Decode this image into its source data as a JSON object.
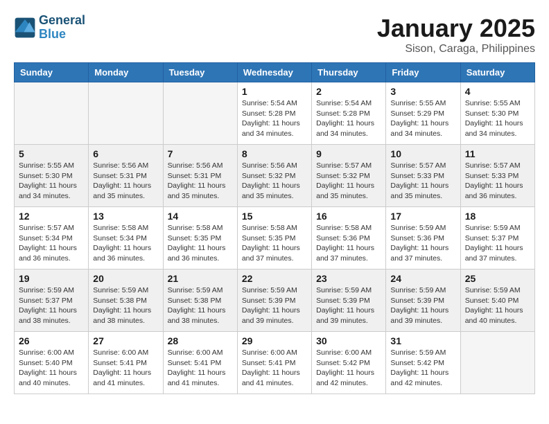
{
  "logo": {
    "line1": "General",
    "line2": "Blue"
  },
  "title": "January 2025",
  "subtitle": "Sison, Caraga, Philippines",
  "weekdays": [
    "Sunday",
    "Monday",
    "Tuesday",
    "Wednesday",
    "Thursday",
    "Friday",
    "Saturday"
  ],
  "weeks": [
    [
      {
        "day": "",
        "sunrise": "",
        "sunset": "",
        "daylight": ""
      },
      {
        "day": "",
        "sunrise": "",
        "sunset": "",
        "daylight": ""
      },
      {
        "day": "",
        "sunrise": "",
        "sunset": "",
        "daylight": ""
      },
      {
        "day": "1",
        "sunrise": "Sunrise: 5:54 AM",
        "sunset": "Sunset: 5:28 PM",
        "daylight": "Daylight: 11 hours and 34 minutes."
      },
      {
        "day": "2",
        "sunrise": "Sunrise: 5:54 AM",
        "sunset": "Sunset: 5:28 PM",
        "daylight": "Daylight: 11 hours and 34 minutes."
      },
      {
        "day": "3",
        "sunrise": "Sunrise: 5:55 AM",
        "sunset": "Sunset: 5:29 PM",
        "daylight": "Daylight: 11 hours and 34 minutes."
      },
      {
        "day": "4",
        "sunrise": "Sunrise: 5:55 AM",
        "sunset": "Sunset: 5:30 PM",
        "daylight": "Daylight: 11 hours and 34 minutes."
      }
    ],
    [
      {
        "day": "5",
        "sunrise": "Sunrise: 5:55 AM",
        "sunset": "Sunset: 5:30 PM",
        "daylight": "Daylight: 11 hours and 34 minutes."
      },
      {
        "day": "6",
        "sunrise": "Sunrise: 5:56 AM",
        "sunset": "Sunset: 5:31 PM",
        "daylight": "Daylight: 11 hours and 35 minutes."
      },
      {
        "day": "7",
        "sunrise": "Sunrise: 5:56 AM",
        "sunset": "Sunset: 5:31 PM",
        "daylight": "Daylight: 11 hours and 35 minutes."
      },
      {
        "day": "8",
        "sunrise": "Sunrise: 5:56 AM",
        "sunset": "Sunset: 5:32 PM",
        "daylight": "Daylight: 11 hours and 35 minutes."
      },
      {
        "day": "9",
        "sunrise": "Sunrise: 5:57 AM",
        "sunset": "Sunset: 5:32 PM",
        "daylight": "Daylight: 11 hours and 35 minutes."
      },
      {
        "day": "10",
        "sunrise": "Sunrise: 5:57 AM",
        "sunset": "Sunset: 5:33 PM",
        "daylight": "Daylight: 11 hours and 35 minutes."
      },
      {
        "day": "11",
        "sunrise": "Sunrise: 5:57 AM",
        "sunset": "Sunset: 5:33 PM",
        "daylight": "Daylight: 11 hours and 36 minutes."
      }
    ],
    [
      {
        "day": "12",
        "sunrise": "Sunrise: 5:57 AM",
        "sunset": "Sunset: 5:34 PM",
        "daylight": "Daylight: 11 hours and 36 minutes."
      },
      {
        "day": "13",
        "sunrise": "Sunrise: 5:58 AM",
        "sunset": "Sunset: 5:34 PM",
        "daylight": "Daylight: 11 hours and 36 minutes."
      },
      {
        "day": "14",
        "sunrise": "Sunrise: 5:58 AM",
        "sunset": "Sunset: 5:35 PM",
        "daylight": "Daylight: 11 hours and 36 minutes."
      },
      {
        "day": "15",
        "sunrise": "Sunrise: 5:58 AM",
        "sunset": "Sunset: 5:35 PM",
        "daylight": "Daylight: 11 hours and 37 minutes."
      },
      {
        "day": "16",
        "sunrise": "Sunrise: 5:58 AM",
        "sunset": "Sunset: 5:36 PM",
        "daylight": "Daylight: 11 hours and 37 minutes."
      },
      {
        "day": "17",
        "sunrise": "Sunrise: 5:59 AM",
        "sunset": "Sunset: 5:36 PM",
        "daylight": "Daylight: 11 hours and 37 minutes."
      },
      {
        "day": "18",
        "sunrise": "Sunrise: 5:59 AM",
        "sunset": "Sunset: 5:37 PM",
        "daylight": "Daylight: 11 hours and 37 minutes."
      }
    ],
    [
      {
        "day": "19",
        "sunrise": "Sunrise: 5:59 AM",
        "sunset": "Sunset: 5:37 PM",
        "daylight": "Daylight: 11 hours and 38 minutes."
      },
      {
        "day": "20",
        "sunrise": "Sunrise: 5:59 AM",
        "sunset": "Sunset: 5:38 PM",
        "daylight": "Daylight: 11 hours and 38 minutes."
      },
      {
        "day": "21",
        "sunrise": "Sunrise: 5:59 AM",
        "sunset": "Sunset: 5:38 PM",
        "daylight": "Daylight: 11 hours and 38 minutes."
      },
      {
        "day": "22",
        "sunrise": "Sunrise: 5:59 AM",
        "sunset": "Sunset: 5:39 PM",
        "daylight": "Daylight: 11 hours and 39 minutes."
      },
      {
        "day": "23",
        "sunrise": "Sunrise: 5:59 AM",
        "sunset": "Sunset: 5:39 PM",
        "daylight": "Daylight: 11 hours and 39 minutes."
      },
      {
        "day": "24",
        "sunrise": "Sunrise: 5:59 AM",
        "sunset": "Sunset: 5:39 PM",
        "daylight": "Daylight: 11 hours and 39 minutes."
      },
      {
        "day": "25",
        "sunrise": "Sunrise: 5:59 AM",
        "sunset": "Sunset: 5:40 PM",
        "daylight": "Daylight: 11 hours and 40 minutes."
      }
    ],
    [
      {
        "day": "26",
        "sunrise": "Sunrise: 6:00 AM",
        "sunset": "Sunset: 5:40 PM",
        "daylight": "Daylight: 11 hours and 40 minutes."
      },
      {
        "day": "27",
        "sunrise": "Sunrise: 6:00 AM",
        "sunset": "Sunset: 5:41 PM",
        "daylight": "Daylight: 11 hours and 41 minutes."
      },
      {
        "day": "28",
        "sunrise": "Sunrise: 6:00 AM",
        "sunset": "Sunset: 5:41 PM",
        "daylight": "Daylight: 11 hours and 41 minutes."
      },
      {
        "day": "29",
        "sunrise": "Sunrise: 6:00 AM",
        "sunset": "Sunset: 5:41 PM",
        "daylight": "Daylight: 11 hours and 41 minutes."
      },
      {
        "day": "30",
        "sunrise": "Sunrise: 6:00 AM",
        "sunset": "Sunset: 5:42 PM",
        "daylight": "Daylight: 11 hours and 42 minutes."
      },
      {
        "day": "31",
        "sunrise": "Sunrise: 5:59 AM",
        "sunset": "Sunset: 5:42 PM",
        "daylight": "Daylight: 11 hours and 42 minutes."
      },
      {
        "day": "",
        "sunrise": "",
        "sunset": "",
        "daylight": ""
      }
    ]
  ]
}
